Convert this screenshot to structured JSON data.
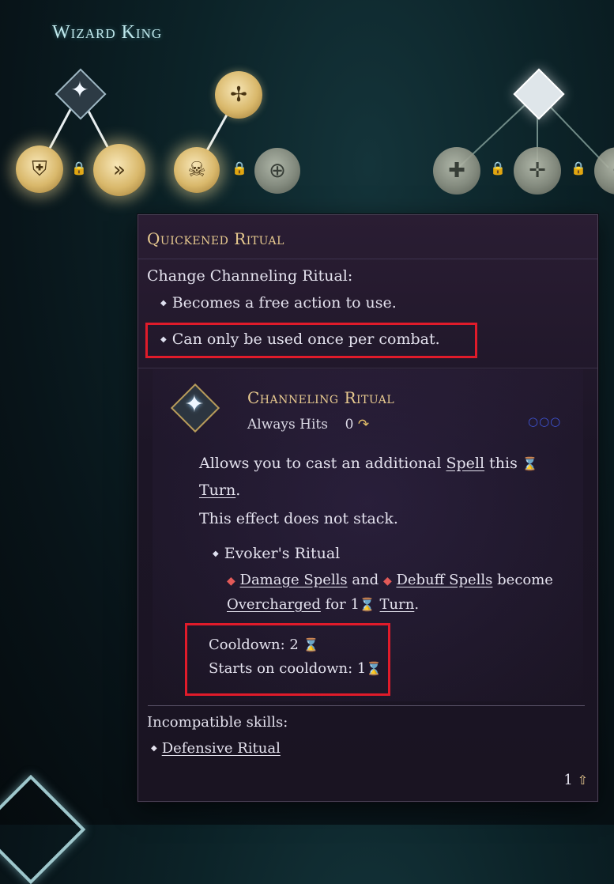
{
  "tree": {
    "title": "Wizard King"
  },
  "tooltip": {
    "title": "Quickened Ritual",
    "intro": "Change Channeling Ritual:",
    "bullets": [
      "Becomes a free action to use.",
      "Can only be used once per combat."
    ],
    "ability": {
      "name": "Channeling Ritual",
      "hit_label": "Always Hits",
      "cost": "0",
      "desc_line1_pre": "Allows you to cast an additional ",
      "desc_spell": "Spell",
      "desc_line1_post": " this ",
      "desc_turn": "Turn",
      "desc_period": ".",
      "desc_line2": "This effect does not stack.",
      "subeffect_title": "Evoker's Ritual",
      "sub_damage": "Damage Spells",
      "sub_and": " and ",
      "sub_debuff": "Debuff Spells",
      "sub_become": " become",
      "sub_overcharged": "Overcharged",
      "sub_for": " for 1",
      "sub_turn": "Turn",
      "sub_period": ".",
      "cooldown": "Cooldown: 2",
      "starts_cooldown": "Starts on cooldown: 1"
    },
    "incompatible_label": "Incompatible skills:",
    "incompatible_item": "Defensive Ritual",
    "level": "1"
  },
  "colors": {
    "highlight_box": "#e01b2a",
    "title_gold": "#e7c98f"
  }
}
